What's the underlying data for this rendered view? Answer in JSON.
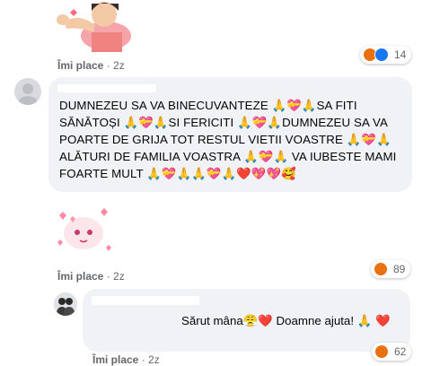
{
  "comment1": {
    "like_label": "Îmi place",
    "time": "2z",
    "reaction_count": "14"
  },
  "comment2": {
    "text": "DUMNEZEU SA VA BINECUVANTEZE 🙏💝🙏SA FITI SĂNĂTOȘI 🙏💝🙏SI FERICITI 🙏💝🙏DUMNEZEU SA VA POARTE DE GRIJA TOT RESTUL VIETII VOASTRE 🙏💝🙏 ALĂTURI DE FAMILIA VOASTRA 🙏💝🙏 VA IUBESTE MAMI FOARTE MULT 🙏💝🙏🙏💝🙏❤️💖💖🥰"
  },
  "comment2_reply_sticker": {
    "like_label": "Îmi place",
    "time": "2z",
    "reaction_count": "89"
  },
  "comment3": {
    "text": "Sărut mâna😤❤️ Doamne ajuta! 🙏 ❤️",
    "reaction_count": "62",
    "like_label": "Îmi place",
    "time": "2z"
  },
  "colors": {
    "bubble": "#f0f2f5",
    "meta_text": "#65676b",
    "angry_reaction": "#e9710f",
    "like_reaction": "#1877f2"
  }
}
